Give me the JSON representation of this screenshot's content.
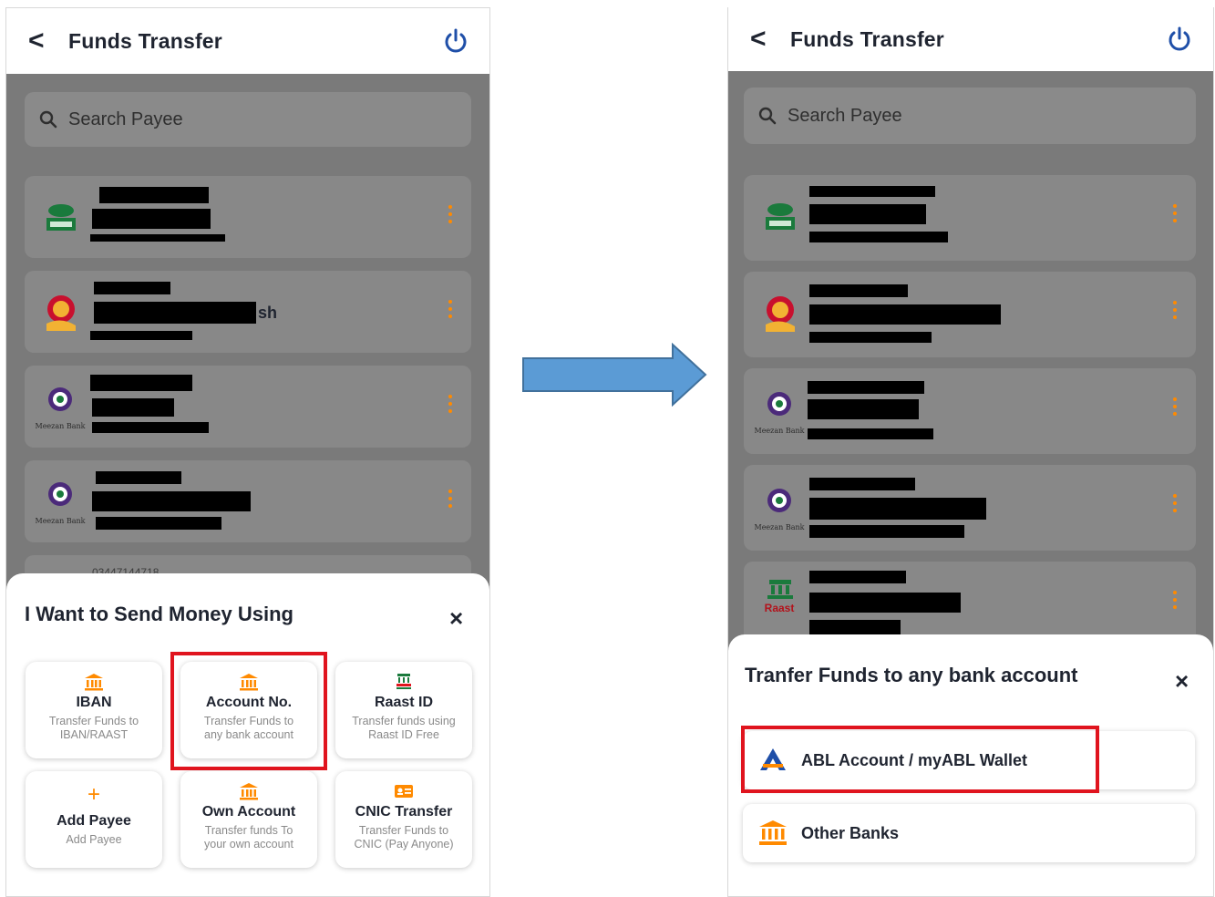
{
  "left_screen": {
    "header": {
      "back": "<",
      "title": "Funds Transfer",
      "power_icon": "power-icon"
    },
    "search": {
      "placeholder": "Search Payee",
      "icon": "search-icon"
    },
    "payees": [
      {
        "bank_logo": "MCB",
        "visible_text": "sh"
      },
      {
        "bank_logo": "Meezan Bank",
        "visible_text": ""
      },
      {
        "bank_logo": "Meezan Bank",
        "visible_text": ""
      }
    ],
    "partial_row_text": "03447144718",
    "sheet": {
      "title": "I Want to Send Money Using",
      "close": "×",
      "options": [
        {
          "title": "IBAN",
          "subtitle_1": "Transfer Funds to",
          "subtitle_2": "IBAN/RAAST",
          "icon": "bank-icon"
        },
        {
          "title": "Account No.",
          "subtitle_1": "Transfer Funds to",
          "subtitle_2": "any bank account",
          "icon": "bank-icon"
        },
        {
          "title": "Raast ID",
          "subtitle_1": "Transfer funds using",
          "subtitle_2": "Raast ID Free",
          "icon": "raast-icon"
        },
        {
          "title": "Add Payee",
          "subtitle_1": "Add Payee",
          "subtitle_2": "",
          "icon": "plus-icon"
        },
        {
          "title": "Own Account",
          "subtitle_1": "Transfer funds To",
          "subtitle_2": "your own account",
          "icon": "bank-icon"
        },
        {
          "title": "CNIC Transfer",
          "subtitle_1": "Transfer Funds to",
          "subtitle_2": "CNIC (Pay Anyone)",
          "icon": "id-card-icon"
        }
      ]
    }
  },
  "right_screen": {
    "header": {
      "back": "<",
      "title": "Funds Transfer",
      "power_icon": "power-icon"
    },
    "search": {
      "placeholder": "Search Payee",
      "icon": "search-icon"
    },
    "payee_logos": [
      "MCB",
      "",
      "Meezan Bank",
      "Meezan Bank",
      "Raast"
    ],
    "sheet": {
      "title": "Tranfer Funds to any bank account",
      "close": "×",
      "options": [
        {
          "label": "ABL Account / myABL Wallet",
          "icon": "abl-logo-icon"
        },
        {
          "label": "Other Banks",
          "icon": "bank-icon"
        }
      ]
    }
  },
  "colors": {
    "accent_orange": "#ff8a00",
    "highlight_red": "#e0141e",
    "power_blue": "#1f4fa8",
    "arrow_blue": "#5b9bd5",
    "overlay_gray": "#7a7a7a"
  }
}
